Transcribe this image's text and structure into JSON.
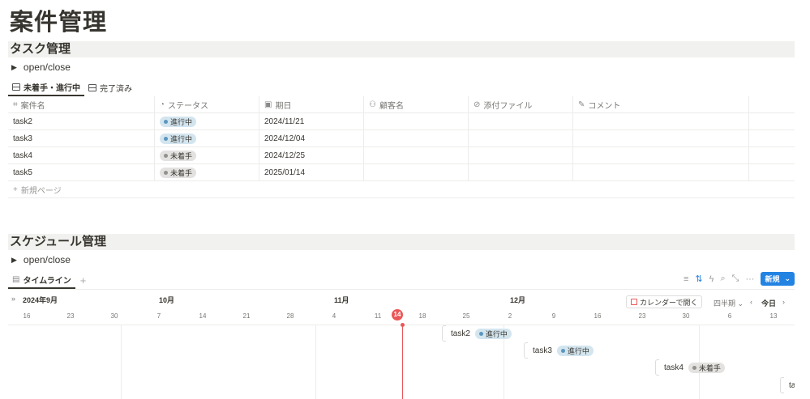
{
  "page": {
    "title": "案件管理"
  },
  "task_section": {
    "heading": "タスク管理",
    "toggle": "open/close",
    "tabs": [
      {
        "label": "未着手・進行中"
      },
      {
        "label": "完了済み"
      }
    ],
    "columns": [
      "案件名",
      "ステータス",
      "期日",
      "顧客名",
      "添付ファイル",
      "コメント"
    ],
    "rows": [
      {
        "name": "task2",
        "status": "進行中",
        "due": "2024/11/21"
      },
      {
        "name": "task3",
        "status": "進行中",
        "due": "2024/12/04"
      },
      {
        "name": "task4",
        "status": "未着手",
        "due": "2024/12/25"
      },
      {
        "name": "task5",
        "status": "未着手",
        "due": "2025/01/14"
      }
    ],
    "new_page": "新規ページ"
  },
  "schedule_section": {
    "heading": "スケジュール管理",
    "toggle": "open/close",
    "tab": "タイムライン",
    "new_button": "新規",
    "calendar_button": "カレンダーで開く",
    "period": "四半期",
    "today_button": "今日",
    "months": [
      "2024年9月",
      "10月",
      "11月",
      "12月"
    ],
    "days": [
      "16",
      "23",
      "30",
      "7",
      "14",
      "21",
      "28",
      "4",
      "11",
      "14",
      "18",
      "25",
      "2",
      "9",
      "16",
      "23",
      "30",
      "6",
      "13"
    ],
    "tasks": [
      {
        "name": "task2",
        "status": "進行中"
      },
      {
        "name": "task3",
        "status": "進行中"
      },
      {
        "name": "task4",
        "status": "未着手"
      },
      {
        "name": "tas",
        "status": ""
      }
    ]
  },
  "colors": {
    "accent": "#2383e2",
    "today": "#eb5757",
    "in_progress": "#d3e5ef",
    "not_started": "#e3e2e0"
  }
}
